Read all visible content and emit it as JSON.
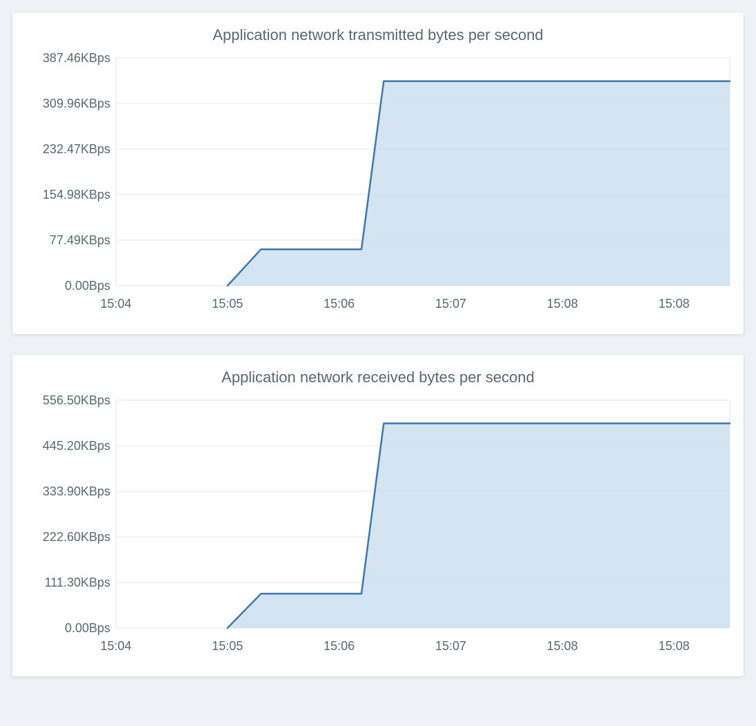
{
  "charts": [
    {
      "title": "Application network transmitted bytes per second",
      "y_ticks": [
        "387.46KBps",
        "309.96KBps",
        "232.47KBps",
        "154.98KBps",
        "77.49KBps",
        "0.00Bps"
      ],
      "x_ticks": [
        "15:04",
        "15:05",
        "15:06",
        "15:07",
        "15:08",
        "15:08"
      ]
    },
    {
      "title": "Application network received bytes per second",
      "y_ticks": [
        "556.50KBps",
        "445.20KBps",
        "333.90KBps",
        "222.60KBps",
        "111.30KBps",
        "0.00Bps"
      ],
      "x_ticks": [
        "15:04",
        "15:05",
        "15:06",
        "15:07",
        "15:08",
        "15:08"
      ]
    }
  ],
  "chart_data": [
    {
      "type": "area",
      "title": "Application network transmitted bytes per second",
      "xlabel": "",
      "ylabel": "",
      "x": [
        "15:04",
        "15:05",
        "15:06",
        "15:07",
        "15:08",
        "15:08"
      ],
      "y_tick_values": [
        0,
        77.49,
        154.98,
        232.47,
        309.96,
        387.46
      ],
      "y_unit": "KBps",
      "ylim": [
        0,
        387.46
      ],
      "series": [
        {
          "name": "transmitted",
          "color": "#3b78b0",
          "points": [
            {
              "x": "15:04",
              "y": 0.0
            },
            {
              "x": "15:05",
              "y": 0.0
            },
            {
              "x": "15:05.3",
              "y": 62.0
            },
            {
              "x": "15:06.2",
              "y": 62.0
            },
            {
              "x": "15:06.4",
              "y": 348.0
            },
            {
              "x": "15:08.5",
              "y": 348.0
            }
          ]
        }
      ]
    },
    {
      "type": "area",
      "title": "Application network received bytes per second",
      "xlabel": "",
      "ylabel": "",
      "x": [
        "15:04",
        "15:05",
        "15:06",
        "15:07",
        "15:08",
        "15:08"
      ],
      "y_tick_values": [
        0,
        111.3,
        222.6,
        333.9,
        445.2,
        556.5
      ],
      "y_unit": "KBps",
      "ylim": [
        0,
        556.5
      ],
      "series": [
        {
          "name": "received",
          "color": "#3b78b0",
          "points": [
            {
              "x": "15:04",
              "y": 0.0
            },
            {
              "x": "15:05",
              "y": 0.0
            },
            {
              "x": "15:05.3",
              "y": 84.0
            },
            {
              "x": "15:06.2",
              "y": 84.0
            },
            {
              "x": "15:06.4",
              "y": 500.0
            },
            {
              "x": "15:08.5",
              "y": 500.0
            }
          ]
        }
      ]
    }
  ]
}
